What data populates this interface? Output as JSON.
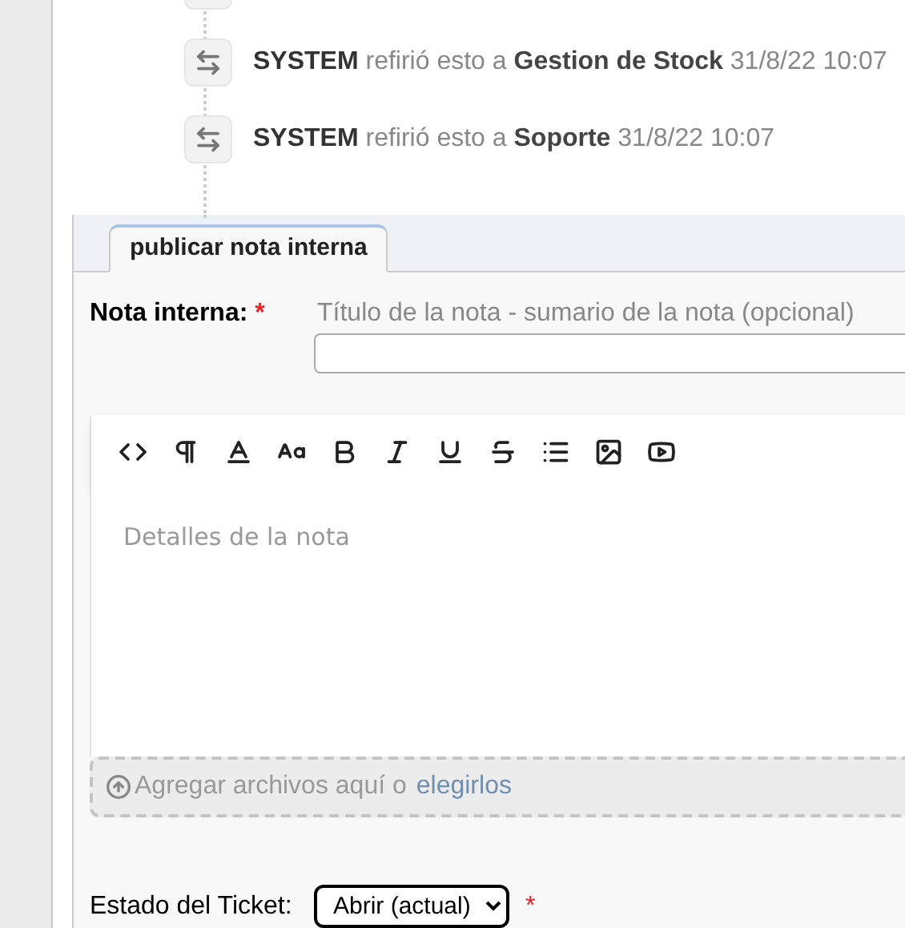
{
  "timeline": [
    {
      "actor": "SYSTEM",
      "action": "refirió esto a",
      "target": "Gestion de Stock",
      "time": "31/8/22 10:07"
    },
    {
      "actor": "SYSTEM",
      "action": "refirió esto a",
      "target": "Soporte",
      "time": "31/8/22 10:07"
    }
  ],
  "tabs": [
    {
      "label": "publicar nota interna",
      "selected": true
    }
  ],
  "note": {
    "label": "Nota interna:",
    "required_mark": "*",
    "title_hint": "Título de la nota - sumario de la nota (opcional)",
    "toolbar": [
      {
        "kind": "code"
      },
      {
        "kind": "paragraph"
      },
      {
        "kind": "color"
      },
      {
        "kind": "size"
      },
      {
        "kind": "bold"
      },
      {
        "kind": "italic"
      },
      {
        "kind": "underline"
      },
      {
        "kind": "strike"
      },
      {
        "kind": "list"
      },
      {
        "kind": "image"
      },
      {
        "kind": "video"
      }
    ],
    "body_placeholder": "Detalles de la nota",
    "dropzone": {
      "text": "Agregar archivos aquí o",
      "link": "elegirlos"
    }
  },
  "status": {
    "label": "Estado del Ticket:",
    "value": "Abrir (actual)",
    "required_mark": "*"
  }
}
